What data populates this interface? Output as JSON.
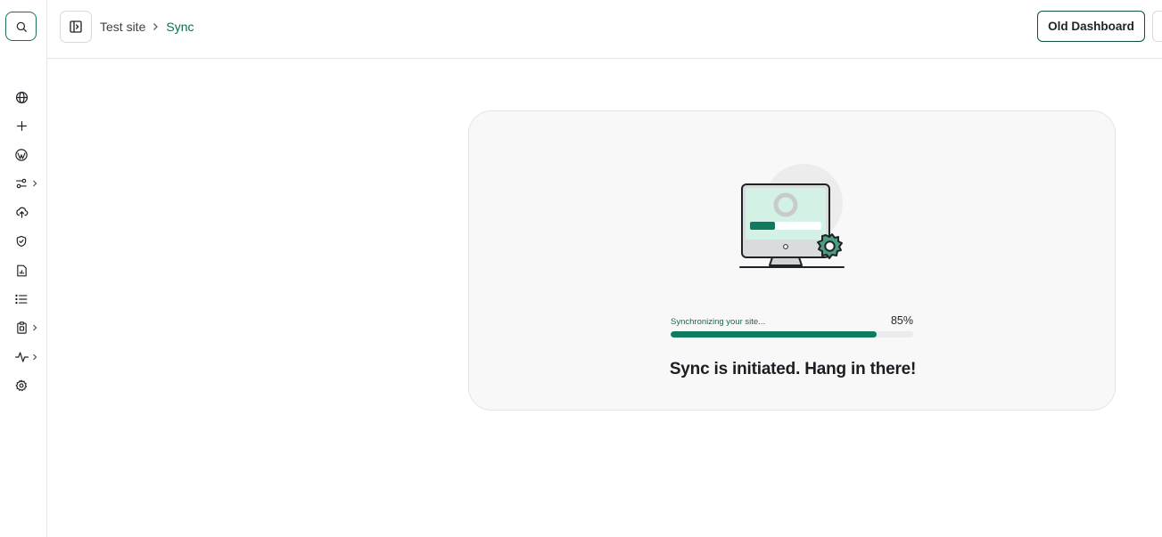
{
  "sidebar": {
    "search_icon": "search-icon",
    "items": [
      {
        "icon": "globe-icon",
        "has_chevron": false
      },
      {
        "icon": "plus-icon",
        "has_chevron": false
      },
      {
        "icon": "wordpress-icon",
        "has_chevron": false
      },
      {
        "icon": "sliders-icon",
        "has_chevron": true
      },
      {
        "icon": "cloud-upload-icon",
        "has_chevron": false
      },
      {
        "icon": "shield-check-icon",
        "has_chevron": false
      },
      {
        "icon": "file-chart-icon",
        "has_chevron": false
      },
      {
        "icon": "list-icon",
        "has_chevron": false
      },
      {
        "icon": "clipboard-icon",
        "has_chevron": true
      },
      {
        "icon": "activity-icon",
        "has_chevron": true
      },
      {
        "icon": "gear-icon",
        "has_chevron": false
      }
    ]
  },
  "header": {
    "breadcrumb": {
      "site": "Test site",
      "current": "Sync"
    },
    "old_dashboard_label": "Old Dashboard"
  },
  "sync": {
    "progress_label": "Synchronizing your site...",
    "progress_percent": 85,
    "progress_text": "85%",
    "headline": "Sync is initiated. Hang in there!"
  },
  "colors": {
    "accent": "#0f7a5e",
    "accent_dark": "#0f4f42",
    "card_bg": "#f8f8f8"
  }
}
